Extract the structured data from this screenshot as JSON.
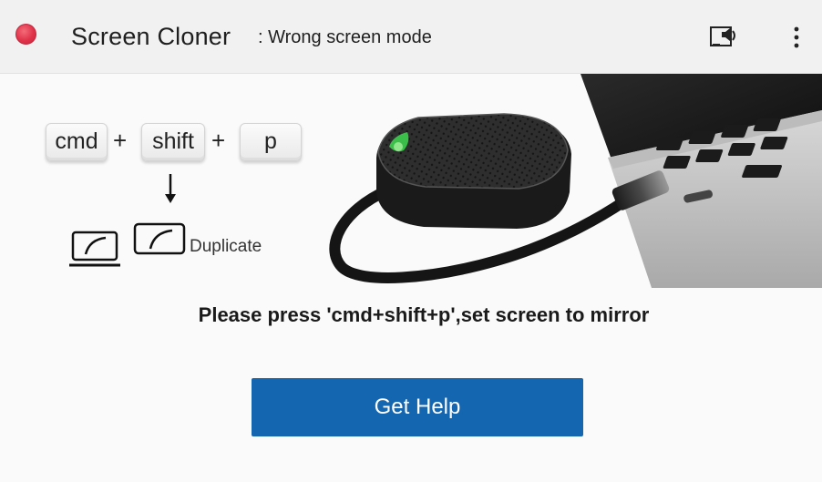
{
  "window": {
    "title": "Screen Cloner",
    "status": ": Wrong screen mode"
  },
  "toolbar": {
    "audio_icon": "screen-audio-icon",
    "menu_icon": "more-vertical-icon"
  },
  "shortcut": {
    "keys": [
      "cmd",
      "shift",
      "p"
    ],
    "separator": "+",
    "mode_label": "Duplicate"
  },
  "main": {
    "instruction": "Please press 'cmd+shift+p',set screen to mirror",
    "help_button_label": "Get Help"
  },
  "colors": {
    "close_dot": "#e0334a",
    "button": "#1566b0",
    "device_led": "#3bbf4a"
  }
}
